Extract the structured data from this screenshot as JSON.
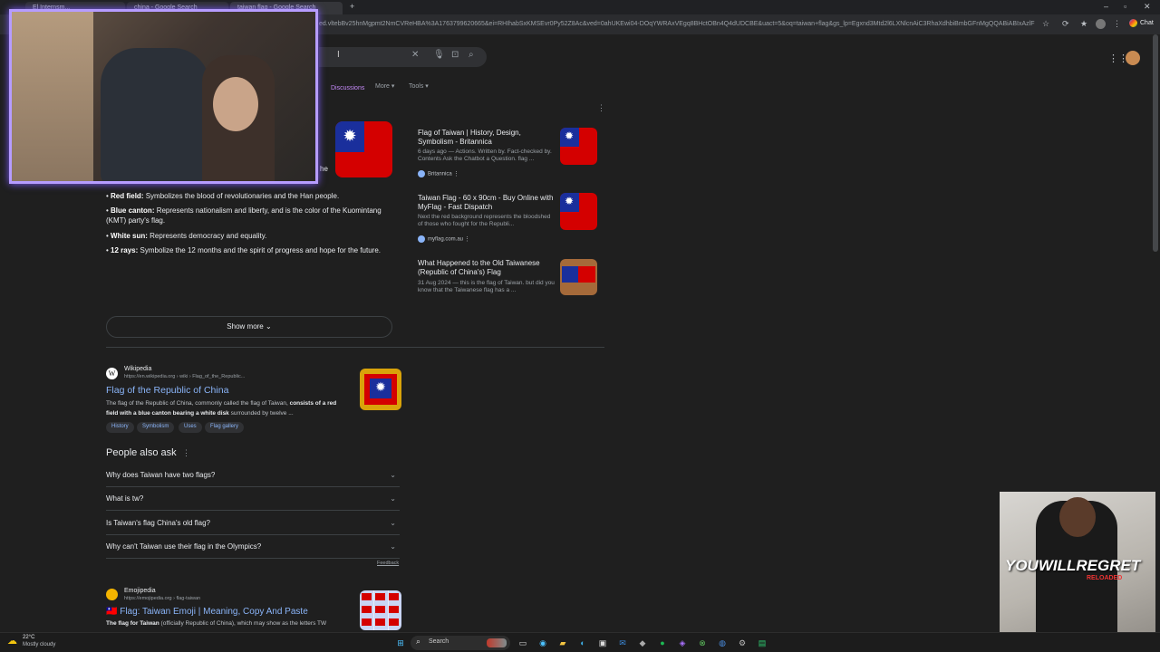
{
  "browser": {
    "tabs": [
      {
        "label": "El Internsm..."
      },
      {
        "label": "china - Google Search"
      },
      {
        "label": "taiwan flag - Google Search"
      }
    ],
    "url": "ed.vltebBv25hnMgpmt2NmCVReHBA%3A1763799620665&ei=RHIhabSxKMSEvr0Py52Z8Ac&ved=0ahUKEwi04-DOqYWRAxVEgq8BHctOBn4Q4dUDCBE&uact=5&oq=taiwan+flag&gs_lp=Egxnd3Mtd2l6LXNlcnAiC3RhaXdhbiBmbGFnMgQQABiABIxAzlFEAAY...",
    "chat_label": "Chat"
  },
  "search": {
    "tabs": {
      "discussions": "Discussions",
      "more": "More",
      "tools": "Tools"
    }
  },
  "overview": {
    "partial": "he",
    "bullets": [
      {
        "term": "Red field:",
        "text": " Symbolizes the blood of revolutionaries and the Han people."
      },
      {
        "term": "Blue canton:",
        "text": " Represents nationalism and liberty, and is the color of the Kuomintang (KMT) party's flag."
      },
      {
        "term": "White sun:",
        "text": " Represents democracy and equality."
      },
      {
        "term": "12 rays:",
        "text": " Symbolize the 12 months and the spirit of progress and hope for the future."
      }
    ],
    "show_more": "Show more"
  },
  "right_cards": [
    {
      "title": "Flag of Taiwan | History, Design, Symbolism - Britannica",
      "snippet": "6 days ago — Actions. Written by. Fact-checked by. Contents Ask the Chatbot a Question. flag ...",
      "source": "Britannica"
    },
    {
      "title": "Taiwan Flag - 60 x 90cm - Buy Online with MyFlag - Fast Dispatch",
      "snippet": "Next the red background represents the bloodshed of those who fought for the Republi...",
      "source": "myflag.com.au"
    },
    {
      "title": "What Happened to the Old Taiwanese (Republic of China's) Flag",
      "snippet": "31 Aug 2024 — this is the flag of Taiwan. but did you know that the Taiwanese flag has a ...",
      "source": ""
    }
  ],
  "wiki": {
    "site": "Wikipedia",
    "url": "https://en.wikipedia.org › wiki › Flag_of_the_Republic...",
    "title": "Flag of the Republic of China",
    "snippet_a": "The flag of the Republic of China, commonly called the flag of Taiwan, ",
    "snippet_b": "consists of a red field with a blue canton bearing a white disk",
    "snippet_c": " surrounded by twelve ...",
    "chips": [
      "History",
      "Symbolism",
      "Uses",
      "Flag gallery"
    ]
  },
  "paa": {
    "heading": "People also ask",
    "questions": [
      "Why does Taiwan have two flags?",
      "What is tw?",
      "Is Taiwan's flag China's old flag?",
      "Why can't Taiwan use their flag in the Olympics?"
    ],
    "feedback": "Feedback"
  },
  "emoji": {
    "site": "Emojipedia",
    "url": "https://emojipedia.org › flag-taiwan",
    "title": "🇹🇼 Flag: Taiwan Emoji | Meaning, Copy And Paste",
    "snippet_b": "The flag for Taiwan",
    "snippet_c": " (officially Republic of China), which may show as the letters TW"
  },
  "overlay": {
    "shirt_text": "YOUWILLREGRET",
    "shirt_sub": "RELOADED"
  },
  "taskbar": {
    "weather_temp": "22°C",
    "weather_desc": "Mostly cloudy",
    "search_label": "Search"
  },
  "colors": {
    "flag_red": "#d40000",
    "flag_blue": "#1a2f9c",
    "link": "#8ab4f8",
    "cam_border": "#b69cff"
  }
}
